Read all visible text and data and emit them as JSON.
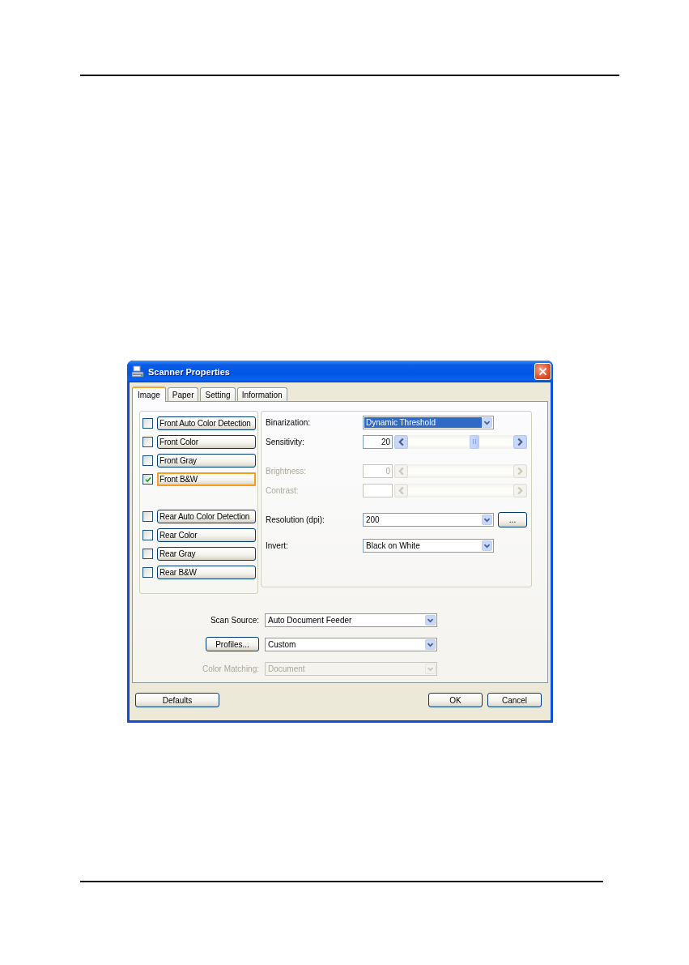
{
  "window": {
    "title": "Scanner Properties"
  },
  "tabs": [
    {
      "label": "Image",
      "selected": true
    },
    {
      "label": "Paper",
      "selected": false
    },
    {
      "label": "Setting",
      "selected": false
    },
    {
      "label": "Information",
      "selected": false
    }
  ],
  "image_types": [
    {
      "items": [
        {
          "label": "Front Auto Color Detection",
          "checked": false,
          "selected": false
        },
        {
          "label": "Front Color",
          "checked": false,
          "selected": false
        },
        {
          "label": "Front Gray",
          "checked": false,
          "selected": false
        },
        {
          "label": "Front B&W",
          "checked": true,
          "selected": true
        }
      ]
    },
    {
      "items": [
        {
          "label": "Rear Auto Color Detection",
          "checked": false,
          "selected": false
        },
        {
          "label": "Rear Color",
          "checked": false,
          "selected": false
        },
        {
          "label": "Rear Gray",
          "checked": false,
          "selected": false
        },
        {
          "label": "Rear B&W",
          "checked": false,
          "selected": false
        }
      ]
    }
  ],
  "setting_groups": [
    {
      "rows": [
        {
          "kind": "dropdown",
          "label": "Binarization:",
          "value": "Dynamic Threshold",
          "focused": true,
          "disabled": false
        },
        {
          "kind": "slider",
          "label": "Sensitivity:",
          "value": "20",
          "level": 0.64,
          "disabled": false
        }
      ]
    },
    {
      "rows": [
        {
          "kind": "slider",
          "label": "Brightness:",
          "value": "0",
          "disabled": true
        },
        {
          "kind": "slider",
          "label": "Contrast:",
          "disabled": true
        }
      ]
    },
    {
      "rows": [
        {
          "kind": "dropdown",
          "label": "Resolution (dpi):",
          "value": "200",
          "focused": false,
          "disabled": false,
          "button": "..."
        },
        {
          "kind": "dropdown",
          "label": "Invert:",
          "value": "Black on White",
          "focused": false,
          "disabled": false
        }
      ]
    }
  ],
  "source_rows": [
    {
      "kind": "label",
      "label": "Scan Source:",
      "value": "Auto Document Feeder",
      "disabled": false
    },
    {
      "kind": "button",
      "label": "Profiles...",
      "value": "Custom",
      "disabled": false
    },
    {
      "kind": "label",
      "label": "Color Matching:",
      "value": "Document",
      "disabled": true
    }
  ],
  "buttons": {
    "left": [
      "Defaults"
    ],
    "right": [
      "OK",
      "Cancel"
    ]
  }
}
